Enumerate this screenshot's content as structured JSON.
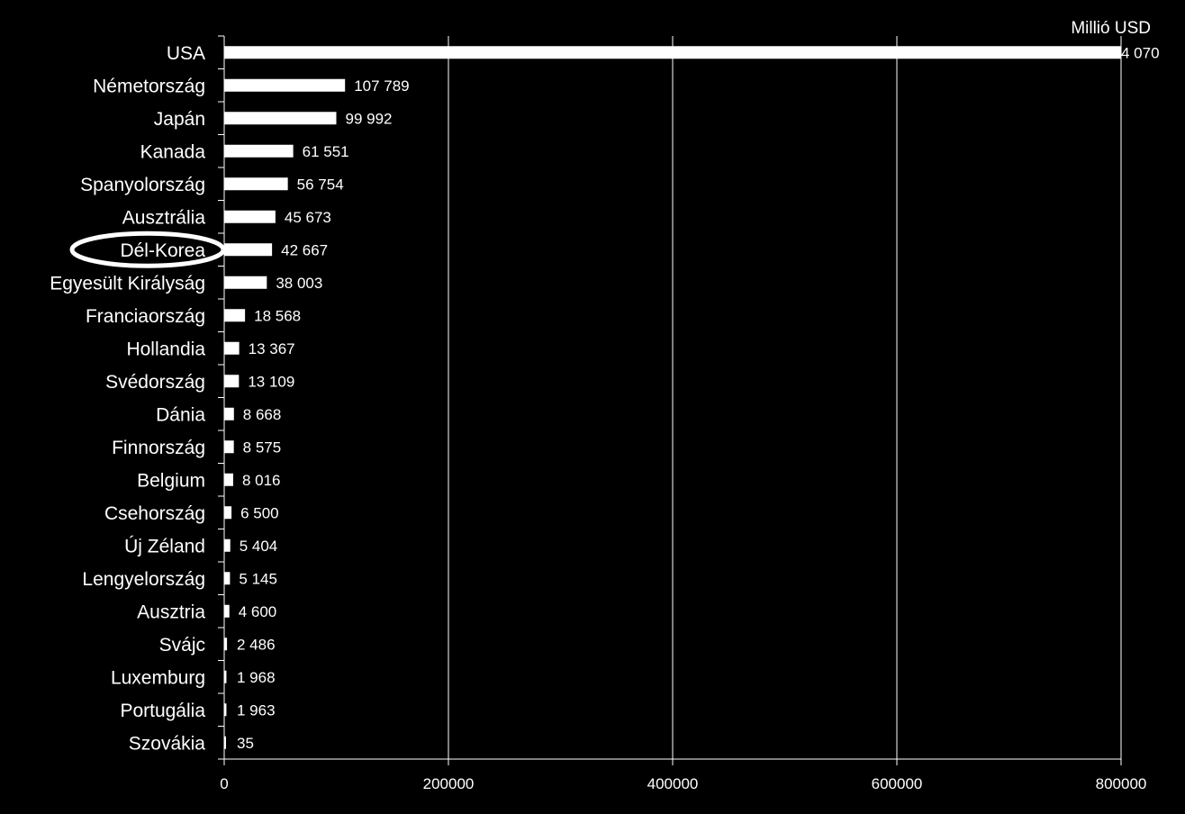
{
  "chart_data": {
    "type": "bar",
    "orientation": "horizontal",
    "unit_label": "Millió  USD",
    "categories": [
      "USA",
      "Németország",
      "Japán",
      "Kanada",
      "Spanyolország",
      "Ausztrália",
      "Dél-Korea",
      "Egyesült Királyság",
      "Franciaország",
      "Hollandia",
      "Svédország",
      "Dánia",
      "Finnország",
      "Belgium",
      "Csehország",
      "Új Zéland",
      "Lengyelország",
      "Ausztria",
      "Svájc",
      "Luxemburg",
      "Portugália",
      "Szovákia"
    ],
    "values": [
      804070,
      107789,
      99992,
      61551,
      56754,
      45673,
      42667,
      38003,
      18568,
      13367,
      13109,
      8668,
      8575,
      8016,
      6500,
      5404,
      5145,
      4600,
      2486,
      1968,
      1963,
      35
    ],
    "value_labels": [
      "4 070",
      "107 789",
      "99 992",
      "61 551",
      "56 754",
      "45 673",
      "42 667",
      "38 003",
      "18 568",
      "13 367",
      "13 109",
      "8 668",
      "8 575",
      "8 016",
      "6 500",
      "5 404",
      "5 145",
      "4 600",
      "2 486",
      "1 968",
      "1 963",
      "35"
    ],
    "xlim": [
      0,
      800000
    ],
    "xticks": [
      0,
      200000,
      400000,
      600000,
      800000
    ],
    "xtick_labels": [
      "0",
      "200000",
      "400000",
      "600000",
      "800000"
    ],
    "grid": true,
    "highlighted_category": "Dél-Korea",
    "colors": {
      "background": "#000000",
      "bar": "#ffffff",
      "text": "#ffffff",
      "grid": "#ffffff"
    }
  }
}
